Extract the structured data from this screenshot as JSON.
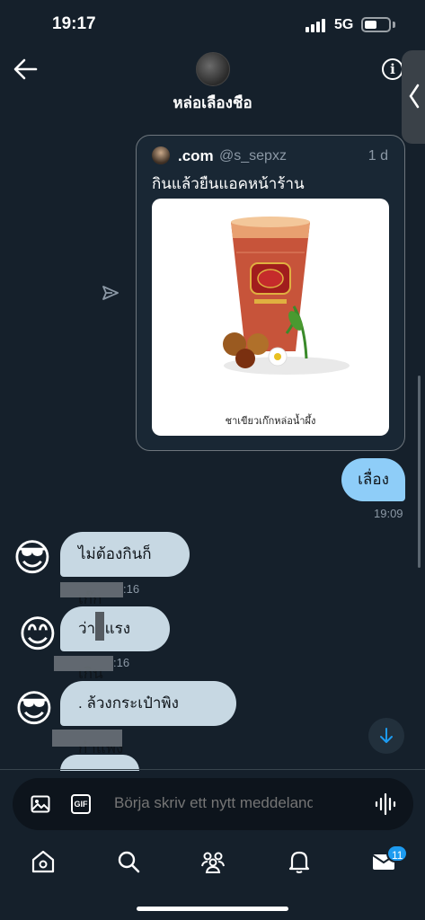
{
  "status_bar": {
    "time": "19:17",
    "network": "5G"
  },
  "header": {
    "title": "หล่อเลืองชือ"
  },
  "shared_tweet": {
    "display_name": ".com",
    "handle": "@s_sepxz",
    "age": "1 d",
    "text": "กินแล้วยืนแอคหน้าร้าน",
    "image_caption": "ชาเขียวเก๊กหล่อน้ำผึ้ง"
  },
  "messages": {
    "outgoing_1": {
      "text": "เลื่อง",
      "time": "19:09"
    },
    "incoming_1": {
      "text": "ไม่ต้องกินก็เก๊ก",
      "emoji": "😎",
      "time_suffix": ":16"
    },
    "incoming_2": {
      "text": "ว่าเ  แรงเกิน",
      "emoji": "😊",
      "time_suffix": ":16"
    },
    "incoming_3": {
      "text": ". ล้วงกระเป๋าพิงกำแพง",
      "emoji": "😎"
    }
  },
  "composer": {
    "placeholder": "Börja skriv ett nytt meddelande"
  },
  "tabs": {
    "messages_badge": "11"
  },
  "colors": {
    "background": "#15202b",
    "outgoing_bubble": "#8ecdf8",
    "incoming_bubble": "#c7d8e3",
    "accent": "#1d9bf0"
  }
}
